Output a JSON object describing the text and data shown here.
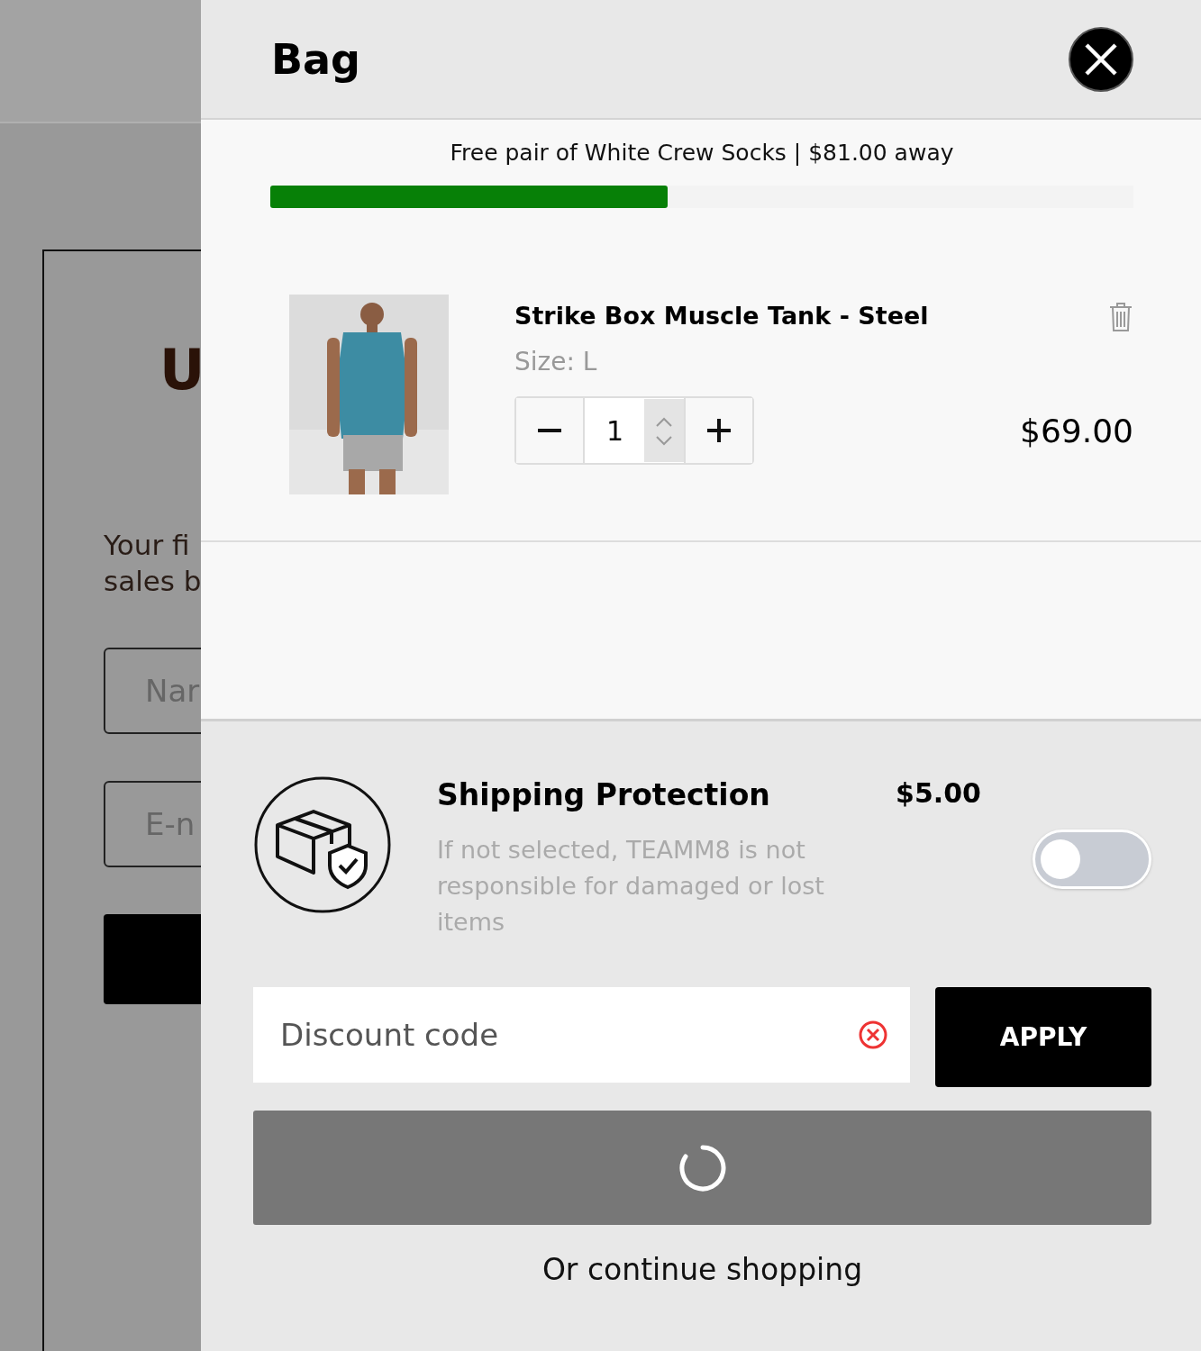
{
  "background_page": {
    "heading": "U",
    "text_lines": [
      "Your fi",
      "sales b"
    ],
    "fields": [
      {
        "placeholder": "Nar"
      },
      {
        "placeholder": "E-n"
      }
    ]
  },
  "drawer": {
    "title": "Bag",
    "free_gift": {
      "message": "Free pair of White Crew Socks | $81.00 away",
      "level": 0.46
    },
    "items": [
      {
        "name": "Strike Box Muscle Tank - Steel",
        "size": "Size: L",
        "quantity": "1",
        "price": "$69.00"
      }
    ],
    "shipping_protection": {
      "title": "Shipping Protection",
      "price": "$5.00",
      "description": "If not selected, TEAMM8 is not responsible for damaged or lost items",
      "on": false
    },
    "discount": {
      "placeholder": "Discount code",
      "button": "APPLY"
    },
    "checkout": {
      "loading": true
    },
    "continue_link": "Or continue shopping"
  }
}
